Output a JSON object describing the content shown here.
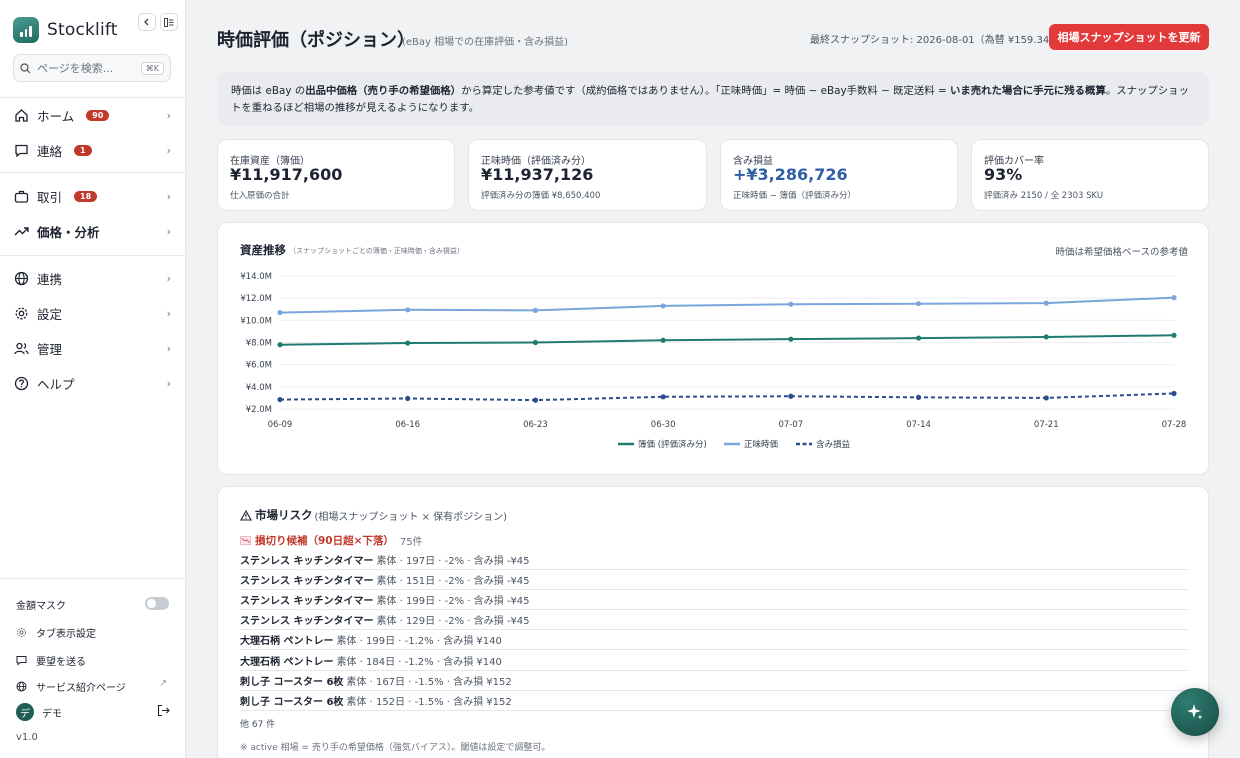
{
  "app": {
    "name": "Stocklift",
    "search_placeholder": "ページを検索...",
    "search_shortcut": "⌘K"
  },
  "sidebar": {
    "items": [
      {
        "label": "ホーム",
        "badge": "90",
        "icon": "home-icon"
      },
      {
        "label": "連絡",
        "badge": "1",
        "icon": "message-icon"
      },
      {
        "label": "取引",
        "badge": "18",
        "icon": "briefcase-icon"
      },
      {
        "label": "価格・分析",
        "badge": "",
        "icon": "trending-up-icon",
        "active": true
      },
      {
        "label": "連携",
        "badge": "",
        "icon": "globe-icon"
      },
      {
        "label": "設定",
        "badge": "",
        "icon": "gear-icon"
      },
      {
        "label": "管理",
        "badge": "",
        "icon": "users-icon"
      },
      {
        "label": "ヘルプ",
        "badge": "",
        "icon": "help-icon"
      }
    ],
    "footer": {
      "mask_label": "金額マスク",
      "tab_settings": "タブ表示設定",
      "feedback": "要望を送る",
      "service_page": "サービス紹介ページ",
      "user_initial": "デ",
      "user_name": "デモ",
      "version": "v1.0"
    }
  },
  "header": {
    "title": "時価評価（ポジション）",
    "subtitle": "(eBay 相場での在庫評価・含み損益)",
    "snapshot": "最終スナップショット: 2026-08-01（為替 ¥159.34/$）",
    "refresh_button": "相場スナップショットを更新"
  },
  "info": {
    "p1": "時価は eBay の",
    "b1": "出品中価格（売り手の希望価格）",
    "p2": "から算定した参考値です（成約価格ではありません）。「正味時価」= 時価 − eBay手数料 − 既定送料 = ",
    "b2": "いま売れた場合に手元に残る概算",
    "p3": "。スナップショットを重ねるほど相場の推移が見えるようになります。"
  },
  "kpis": [
    {
      "label": "在庫資産（簿価）",
      "value": "¥11,917,600",
      "note": "仕入原価の合計"
    },
    {
      "label": "正味時価（評価済み分）",
      "value": "¥11,937,126",
      "note": "評価済み分の簿価 ¥8,650,400"
    },
    {
      "label": "含み損益",
      "value": "+¥3,286,726",
      "note": "正味時価 − 簿価（評価済み分）"
    },
    {
      "label": "評価カバー率",
      "value": "93%",
      "note": "評価済み 2150 / 全 2303 SKU"
    }
  ],
  "chart": {
    "title": "資産推移",
    "subtitle": "（スナップショットごとの簿価・正味時価・含み損益）",
    "note": "時価は希望価格ベースの参考値"
  },
  "chart_data": {
    "type": "line",
    "x": [
      "06-09",
      "06-16",
      "06-23",
      "06-30",
      "07-07",
      "07-14",
      "07-21",
      "07-28"
    ],
    "ylim": [
      2.0,
      14.0
    ],
    "yticks": [
      "¥2.0M",
      "¥4.0M",
      "¥6.0M",
      "¥8.0M",
      "¥10.0M",
      "¥12.0M",
      "¥14.0M"
    ],
    "grid": true,
    "legend": "bottom",
    "series": [
      {
        "name": "簿価 (評価済み分)",
        "values": [
          7.8,
          7.95,
          8.0,
          8.2,
          8.3,
          8.4,
          8.5,
          8.65
        ],
        "color": "#1f7a70",
        "style": "solid"
      },
      {
        "name": "正味時価",
        "values": [
          10.7,
          10.95,
          10.9,
          11.3,
          11.45,
          11.5,
          11.55,
          12.05
        ],
        "color": "#7aa6dc",
        "style": "solid"
      },
      {
        "name": "含み損益",
        "values": [
          2.85,
          2.95,
          2.8,
          3.1,
          3.15,
          3.05,
          3.0,
          3.4
        ],
        "color": "#2b4c8c",
        "style": "dashed"
      }
    ]
  },
  "risk": {
    "title": "市場リスク",
    "subtitle": "(相場スナップショット × 保有ポジション)",
    "cut_label": "損切り候補（90日超×下落）",
    "cut_count": "75件",
    "rows": [
      {
        "name": "ステンレス キッチンタイマー",
        "detail": "素体 · 197日 · -2% · 含み損 -¥45"
      },
      {
        "name": "ステンレス キッチンタイマー",
        "detail": "素体 · 151日 · -2% · 含み損 -¥45"
      },
      {
        "name": "ステンレス キッチンタイマー",
        "detail": "素体 · 199日 · -2% · 含み損 -¥45"
      },
      {
        "name": "ステンレス キッチンタイマー",
        "detail": "素体 · 129日 · -2% · 含み損 -¥45"
      },
      {
        "name": "大理石柄 ペントレー",
        "detail": "素体 · 199日 · -1.2% · 含み損 ¥140"
      },
      {
        "name": "大理石柄 ペントレー",
        "detail": "素体 · 184日 · -1.2% · 含み損 ¥140"
      },
      {
        "name": "刺し子 コースター 6枚",
        "detail": "素体 · 167日 · -1.5% · 含み損 ¥152"
      },
      {
        "name": "刺し子 コースター 6枚",
        "detail": "素体 · 152日 · -1.5% · 含み損 ¥152"
      }
    ],
    "more": "他 67 件",
    "footnote": "※ active 相場 = 売り手の希望価格（強気バイアス）。閾値は設定で調整可。"
  }
}
